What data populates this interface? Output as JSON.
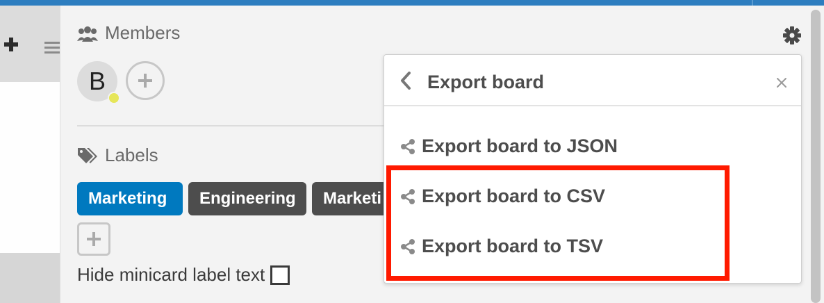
{
  "sidebar": {
    "members": {
      "title": "Members",
      "avatar_initial": "B"
    },
    "labels": {
      "title": "Labels",
      "items": [
        {
          "label": "Marketing",
          "color": "#0079bf"
        },
        {
          "label": "Engineering",
          "color": "#4d4d4d"
        },
        {
          "label": "Marketi",
          "color": "#4d4d4d"
        }
      ]
    },
    "hide_minicard_label_text": "Hide minicard label text"
  },
  "popup": {
    "title": "Export board",
    "items": [
      {
        "label": "Export board to JSON"
      },
      {
        "label": "Export board to CSV"
      },
      {
        "label": "Export board to TSV"
      }
    ]
  },
  "colors": {
    "accent": "#2d7dbf",
    "highlight": "#ff1a00"
  },
  "icons": [
    "plus-icon",
    "menu-icon",
    "members-icon",
    "gear-icon",
    "add-member-icon",
    "tag-icon",
    "add-label-icon",
    "back-icon",
    "close-icon",
    "share-icon"
  ]
}
